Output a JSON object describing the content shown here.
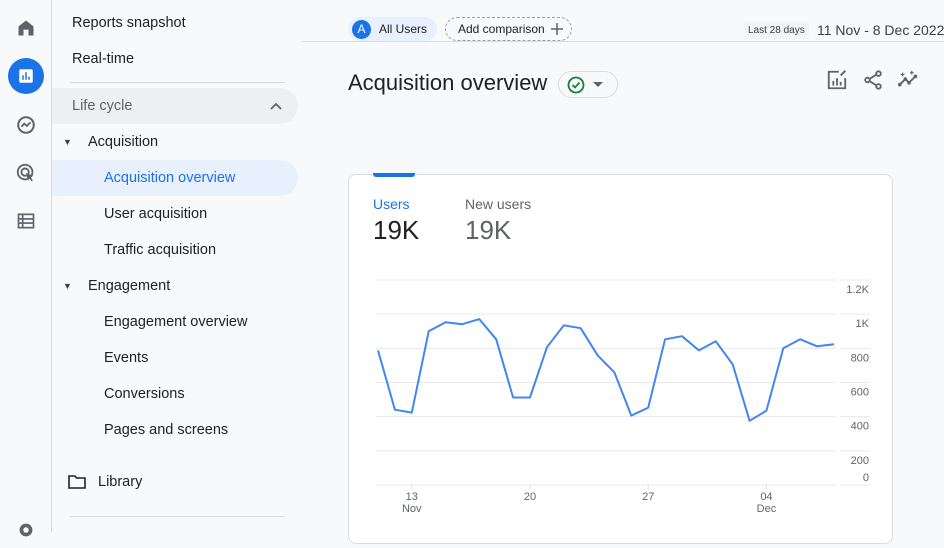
{
  "rail": {
    "items": [
      {
        "icon": "home-icon"
      },
      {
        "icon": "reports-icon",
        "active": true
      },
      {
        "icon": "explore-icon"
      },
      {
        "icon": "advertising-icon"
      },
      {
        "icon": "configure-icon"
      },
      {
        "icon": "settings-icon"
      }
    ]
  },
  "nav": {
    "reports_snapshot": "Reports snapshot",
    "realtime": "Real-time",
    "lifecycle": "Life cycle",
    "acquisition": "Acquisition",
    "acquisition_overview": "Acquisition overview",
    "user_acquisition": "User acquisition",
    "traffic_acquisition": "Traffic acquisition",
    "engagement": "Engagement",
    "engagement_overview": "Engagement overview",
    "events": "Events",
    "conversions": "Conversions",
    "pages_and_screens": "Pages and screens",
    "library": "Library"
  },
  "topbar": {
    "segment_avatar": "A",
    "segment_label": "All Users",
    "add_comparison": "Add comparison",
    "date_label": "Last 28 days",
    "date_range": "11 Nov - 8 Dec 2022"
  },
  "header": {
    "title": "Acquisition overview"
  },
  "card": {
    "metrics": [
      {
        "label": "Users",
        "value": "19K",
        "active": true
      },
      {
        "label": "New users",
        "value": "19K",
        "active": false
      }
    ]
  },
  "colors": {
    "accent": "#1a73e8",
    "line": "#4285f4",
    "success": "#188038"
  },
  "chart_data": {
    "type": "line",
    "title": "",
    "xlabel": "",
    "ylabel": "",
    "ylim": [
      0,
      1200
    ],
    "yticks": [
      0,
      200,
      400,
      600,
      800,
      1000,
      1200
    ],
    "ytick_labels": [
      "0",
      "200",
      "400",
      "600",
      "800",
      "1K",
      "1.2K"
    ],
    "xtick_labels": [
      {
        "index": 2,
        "day": "13",
        "month": "Nov"
      },
      {
        "index": 9,
        "day": "20",
        "month": ""
      },
      {
        "index": 16,
        "day": "27",
        "month": ""
      },
      {
        "index": 23,
        "day": "04",
        "month": "Dec"
      }
    ],
    "grid": true,
    "legend": "none",
    "series": [
      {
        "name": "Users",
        "values": [
          788,
          441,
          424,
          900,
          953,
          941,
          971,
          853,
          512,
          512,
          806,
          935,
          918,
          759,
          659,
          406,
          453,
          853,
          871,
          788,
          841,
          706,
          376,
          435,
          800,
          853,
          812,
          824
        ]
      }
    ]
  }
}
